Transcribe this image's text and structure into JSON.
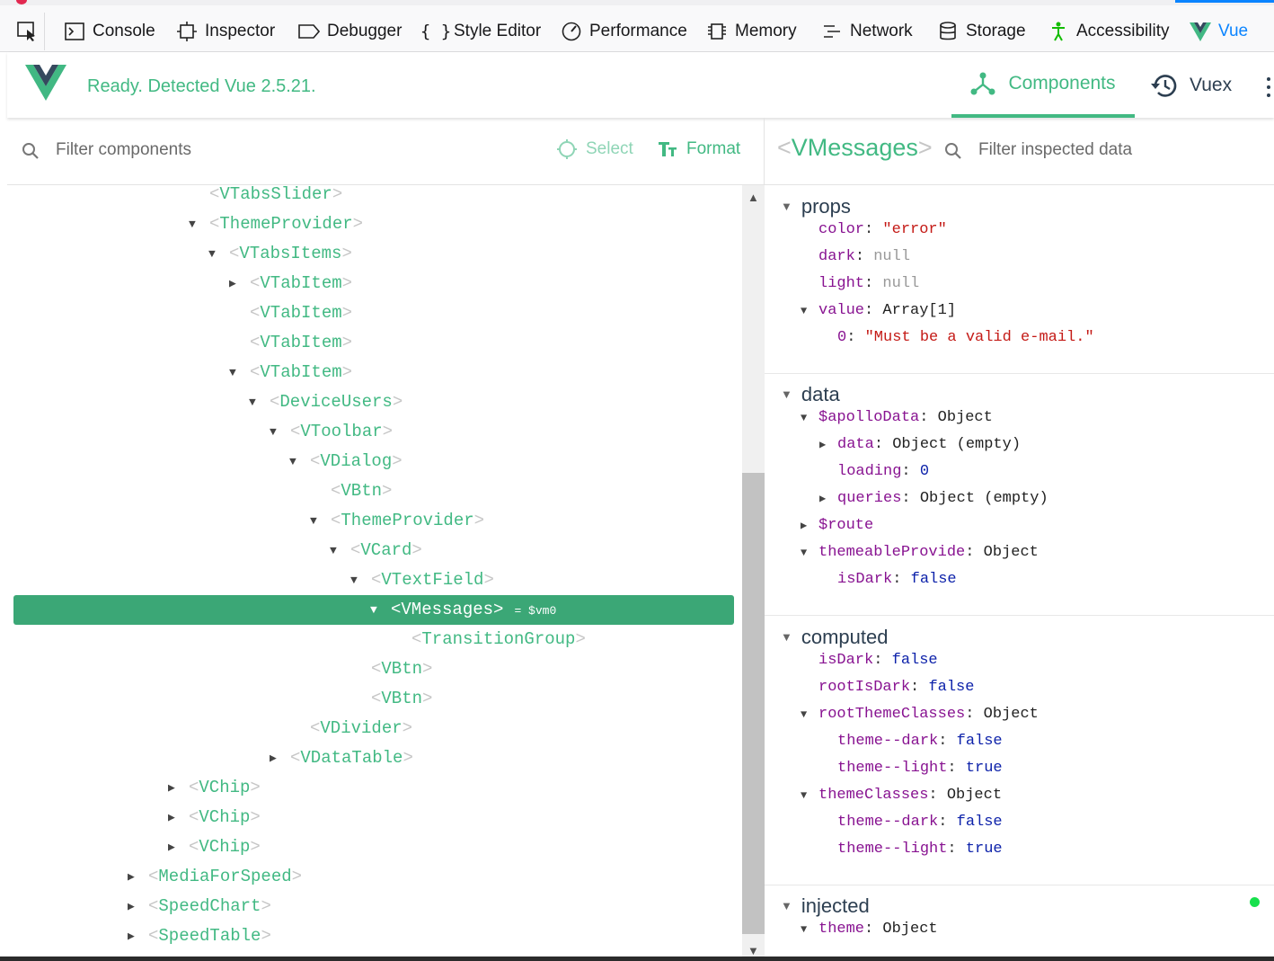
{
  "devtools": {
    "tabs": [
      {
        "label": "Console",
        "icon": "console-icon"
      },
      {
        "label": "Inspector",
        "icon": "inspector-icon"
      },
      {
        "label": "Debugger",
        "icon": "debugger-icon"
      },
      {
        "label": "Style Editor",
        "icon": "braces-icon"
      },
      {
        "label": "Performance",
        "icon": "performance-icon"
      },
      {
        "label": "Memory",
        "icon": "memory-icon"
      },
      {
        "label": "Network",
        "icon": "network-icon"
      },
      {
        "label": "Storage",
        "icon": "storage-icon"
      },
      {
        "label": "Accessibility",
        "icon": "accessibility-icon"
      },
      {
        "label": "Vue",
        "icon": "vue-icon",
        "selected": true
      }
    ]
  },
  "header": {
    "status": "Ready. Detected Vue 2.5.21.",
    "tabs": [
      {
        "label": "Components",
        "icon": "components-icon",
        "active": true
      },
      {
        "label": "Vuex",
        "icon": "history-icon"
      }
    ],
    "accent": "#42b983"
  },
  "components_pane": {
    "filter_placeholder": "Filter components",
    "select_label": "Select",
    "format_label": "Format",
    "tree": [
      {
        "name": "VTabsSlider",
        "arrow": ""
      },
      {
        "name": "ThemeProvider",
        "arrow": "down"
      },
      {
        "name": "VTabsItems",
        "arrow": "down"
      },
      {
        "name": "VTabItem",
        "arrow": "right"
      },
      {
        "name": "VTabItem",
        "arrow": ""
      },
      {
        "name": "VTabItem",
        "arrow": ""
      },
      {
        "name": "VTabItem",
        "arrow": "down"
      },
      {
        "name": "DeviceUsers",
        "arrow": "down"
      },
      {
        "name": "VToolbar",
        "arrow": "down"
      },
      {
        "name": "VDialog",
        "arrow": "down"
      },
      {
        "name": "VBtn",
        "arrow": ""
      },
      {
        "name": "ThemeProvider",
        "arrow": "down"
      },
      {
        "name": "VCard",
        "arrow": "down"
      },
      {
        "name": "VTextField",
        "arrow": "down"
      },
      {
        "name": "VMessages",
        "arrow": "down",
        "selected": true,
        "vm": "= $vm0"
      },
      {
        "name": "TransitionGroup",
        "arrow": ""
      },
      {
        "name": "VBtn",
        "arrow": ""
      },
      {
        "name": "VBtn",
        "arrow": ""
      },
      {
        "name": "VDivider",
        "arrow": ""
      },
      {
        "name": "VDataTable",
        "arrow": "right"
      },
      {
        "name": "VChip",
        "arrow": "right"
      },
      {
        "name": "VChip",
        "arrow": "right"
      },
      {
        "name": "VChip",
        "arrow": "right"
      },
      {
        "name": "MediaForSpeed",
        "arrow": "right"
      },
      {
        "name": "SpeedChart",
        "arrow": "right"
      },
      {
        "name": "SpeedTable",
        "arrow": "right"
      }
    ]
  },
  "inspector": {
    "component_name": "VMessages",
    "filter_placeholder": "Filter inspected data",
    "sections": {
      "props": {
        "title": "props",
        "rows": [
          {
            "key": "color",
            "value": "\"error\"",
            "type": "str"
          },
          {
            "key": "dark",
            "value": "null",
            "type": "null"
          },
          {
            "key": "light",
            "value": "null",
            "type": "null"
          },
          {
            "key": "value",
            "value": "Array[1]",
            "type": "obj",
            "arrow": "down"
          },
          {
            "key": "0",
            "value": "\"Must be a valid e-mail.\"",
            "type": "str"
          }
        ]
      },
      "data": {
        "title": "data",
        "rows": [
          {
            "key": "$apolloData",
            "value": "Object",
            "type": "obj",
            "arrow": "down"
          },
          {
            "key": "data",
            "value": "Object (empty)",
            "type": "obj",
            "arrow": "right"
          },
          {
            "key": "loading",
            "value": "0",
            "type": "num"
          },
          {
            "key": "queries",
            "value": "Object (empty)",
            "type": "obj",
            "arrow": "right"
          },
          {
            "key": "$route",
            "value": "",
            "type": "obj",
            "arrow": "right"
          },
          {
            "key": "themeableProvide",
            "value": "Object",
            "type": "obj",
            "arrow": "down"
          },
          {
            "key": "isDark",
            "value": "false",
            "type": "bool"
          }
        ]
      },
      "computed": {
        "title": "computed",
        "rows": [
          {
            "key": "isDark",
            "value": "false",
            "type": "bool"
          },
          {
            "key": "rootIsDark",
            "value": "false",
            "type": "bool"
          },
          {
            "key": "rootThemeClasses",
            "value": "Object",
            "type": "obj",
            "arrow": "down"
          },
          {
            "key": "theme--dark",
            "value": "false",
            "type": "bool"
          },
          {
            "key": "theme--light",
            "value": "true",
            "type": "bool"
          },
          {
            "key": "themeClasses",
            "value": "Object",
            "type": "obj",
            "arrow": "down"
          },
          {
            "key": "theme--dark",
            "value": "false",
            "type": "bool"
          },
          {
            "key": "theme--light",
            "value": "true",
            "type": "bool"
          }
        ]
      },
      "injected": {
        "title": "injected",
        "rows": [
          {
            "key": "theme",
            "value": "Object",
            "type": "obj",
            "arrow": "down"
          }
        ]
      }
    }
  }
}
